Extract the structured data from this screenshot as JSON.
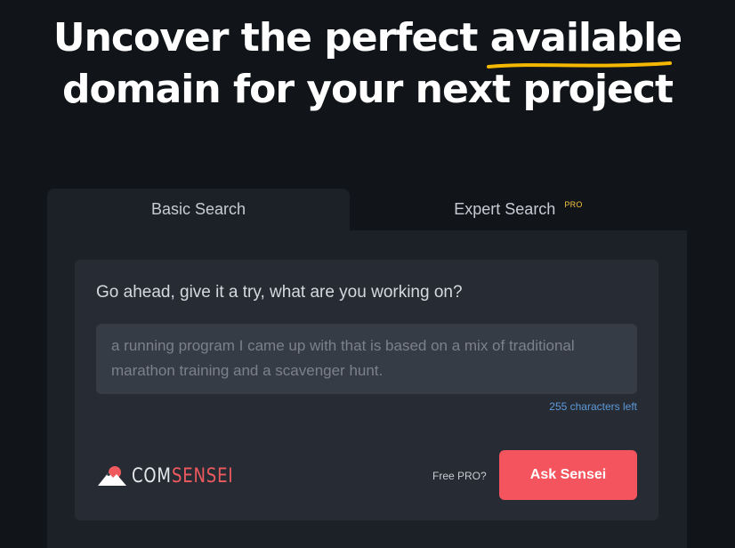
{
  "hero": {
    "line1_part1": "Uncover the perfect ",
    "line1_highlight": "available",
    "line2": "domain for your next project",
    "underline_color": "#f5b800"
  },
  "tabs": {
    "basic_label": "Basic Search",
    "expert_label": "Expert Search",
    "expert_badge": "PRO",
    "active": "basic"
  },
  "form": {
    "prompt": "Go ahead, give it a try, what are you working on?",
    "placeholder": "a running program I came up with that is based on a mix of traditional marathon training and a scavenger hunt.",
    "value": "",
    "char_count": "255 characters left"
  },
  "brand": {
    "name_part1": "COM",
    "name_part2": "SENSEI",
    "logo_icon": "mountain-sun-icon",
    "accent_color": "#ef5a5f"
  },
  "actions": {
    "free_pro_label": "Free PRO?",
    "ask_label": "Ask Sensei",
    "ask_color": "#f4545d"
  }
}
